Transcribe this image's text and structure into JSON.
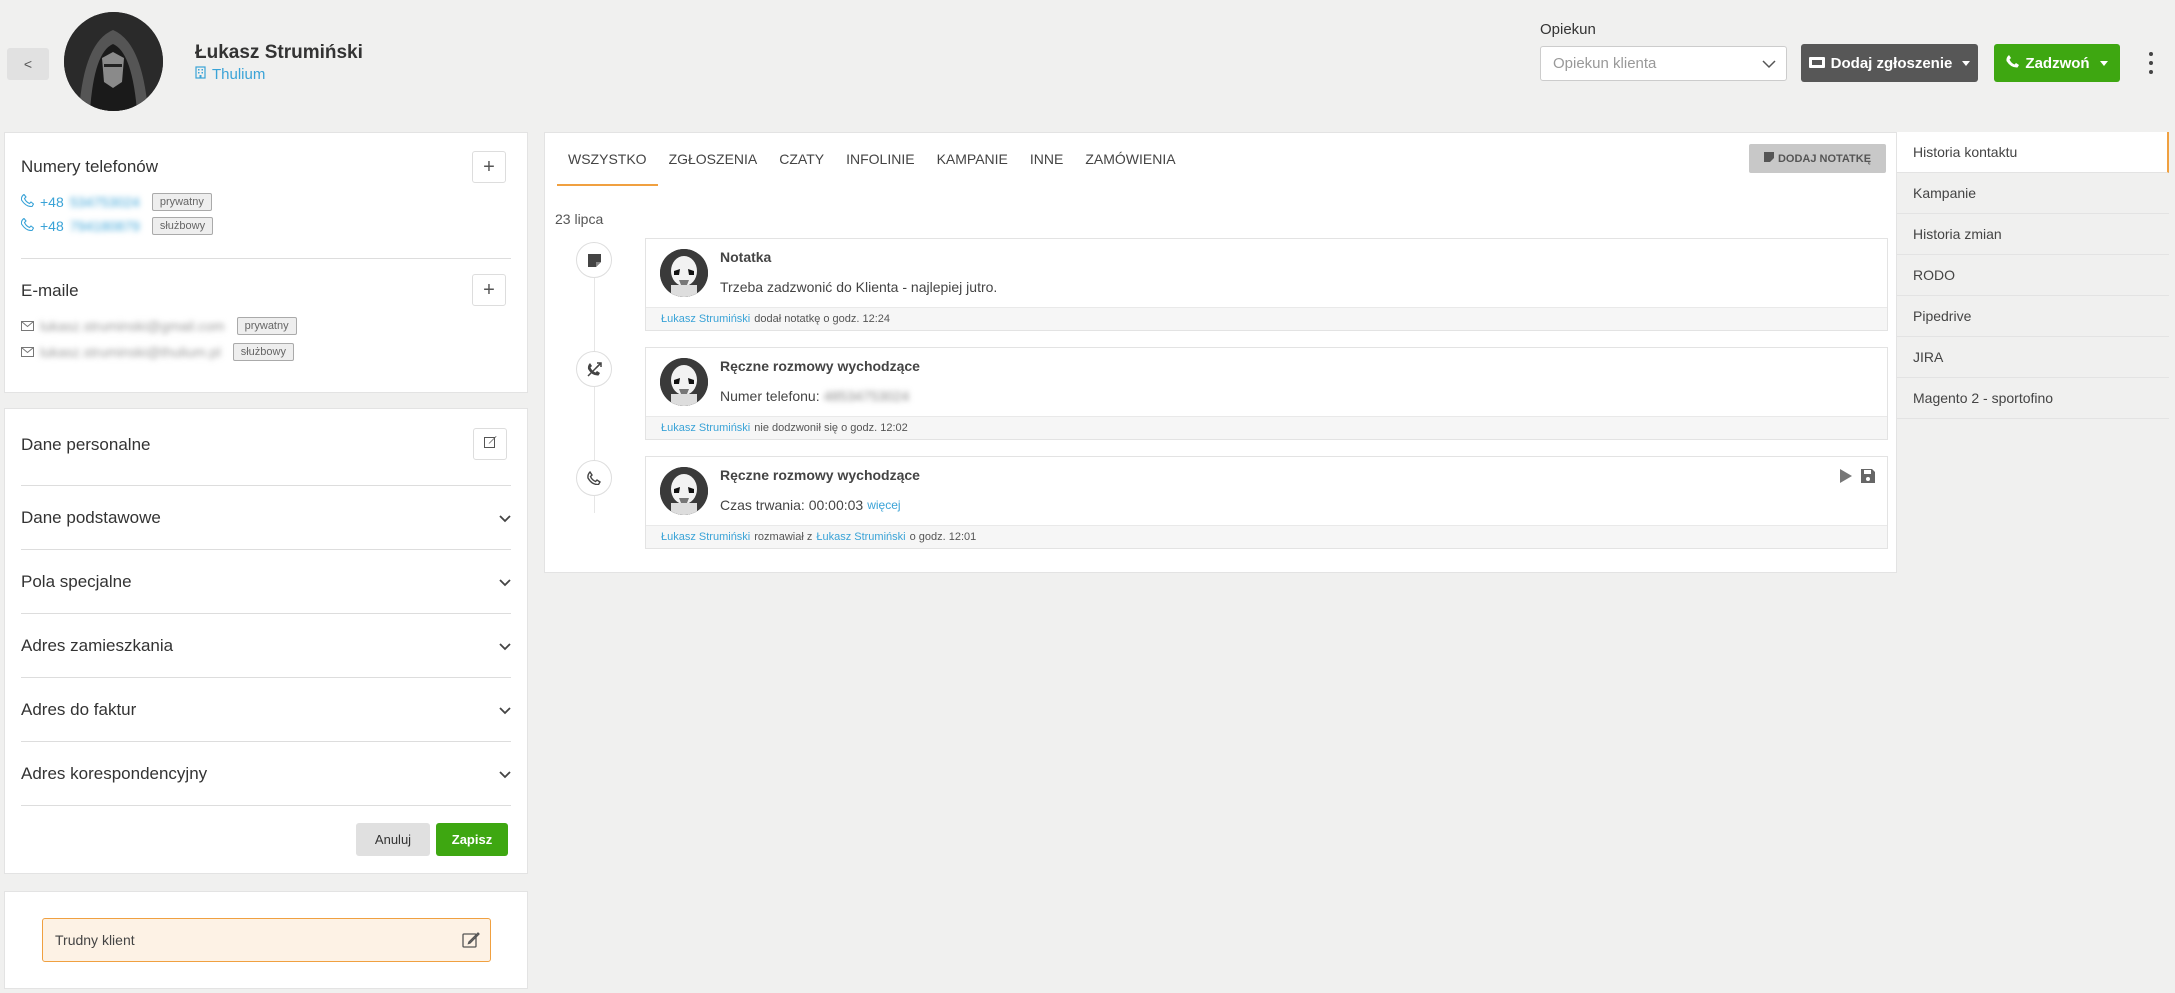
{
  "header": {
    "back_label": "<",
    "client_name": "Łukasz Strumiński",
    "company": "Thulium",
    "opiekun_label": "Opiekun",
    "opiekun_placeholder": "Opiekun klienta",
    "add_ticket_label": "Dodaj zgłoszenie",
    "call_label": "Zadzwoń"
  },
  "contacts": {
    "phones_title": "Numery telefonów",
    "phones": [
      {
        "prefix": "+48",
        "number": "534753024",
        "type": "prywatny"
      },
      {
        "prefix": "+48",
        "number": "794180879",
        "type": "służbowy"
      }
    ],
    "emails_title": "E-maile",
    "emails": [
      {
        "address": "lukasz.struminski@gmail.com",
        "type": "prywatny"
      },
      {
        "address": "lukasz.struminski@thulium.pl",
        "type": "służbowy"
      }
    ]
  },
  "personal": {
    "title": "Dane personalne",
    "sections": [
      "Dane podstawowe",
      "Pola specjalne",
      "Adres zamieszkania",
      "Adres do faktur",
      "Adres korespondencyjny"
    ],
    "cancel_label": "Anuluj",
    "save_label": "Zapisz"
  },
  "note": {
    "text": "Trudny klient"
  },
  "history": {
    "tabs": [
      "WSZYSTKO",
      "ZGŁOSZENIA",
      "CZATY",
      "INFOLINIE",
      "KAMPANIE",
      "INNE",
      "ZAMÓWIENIA"
    ],
    "active_tab": "WSZYSTKO",
    "add_note_label": "DODAJ NOTATKĘ",
    "date": "23 lipca",
    "items": [
      {
        "icon": "note-icon",
        "title": "Notatka",
        "text": "Trzeba zadzwonić do Klienta - najlepiej jutro.",
        "footer_user": "Łukasz Strumiński",
        "footer_action": "dodał notatkę o godz. 12:24"
      },
      {
        "icon": "missed-call-icon",
        "title": "Ręczne rozmowy wychodzące",
        "text_label": "Numer telefonu:",
        "text_value": "48534753024",
        "footer_user": "Łukasz Strumiński",
        "footer_action": "nie dodzwonił się o godz. 12:02"
      },
      {
        "icon": "phone-icon",
        "title": "Ręczne rozmowy wychodzące",
        "text_label": "Czas trwania: 00:00:03",
        "more_label": "więcej",
        "footer_user": "Łukasz Strumiński",
        "footer_mid": "rozmawiał z",
        "footer_user2": "Łukasz Strumiński",
        "footer_action": "o godz. 12:01"
      }
    ]
  },
  "right_nav": {
    "items": [
      "Historia kontaktu",
      "Kampanie",
      "Historia zmian",
      "RODO",
      "Pipedrive",
      "JIRA",
      "Magento 2 - sportofino"
    ],
    "active": "Historia kontaktu"
  },
  "colors": {
    "accent_orange": "#f0a040",
    "green": "#3ea711",
    "link_blue": "#3aa3d7",
    "dark_button": "#575757"
  }
}
